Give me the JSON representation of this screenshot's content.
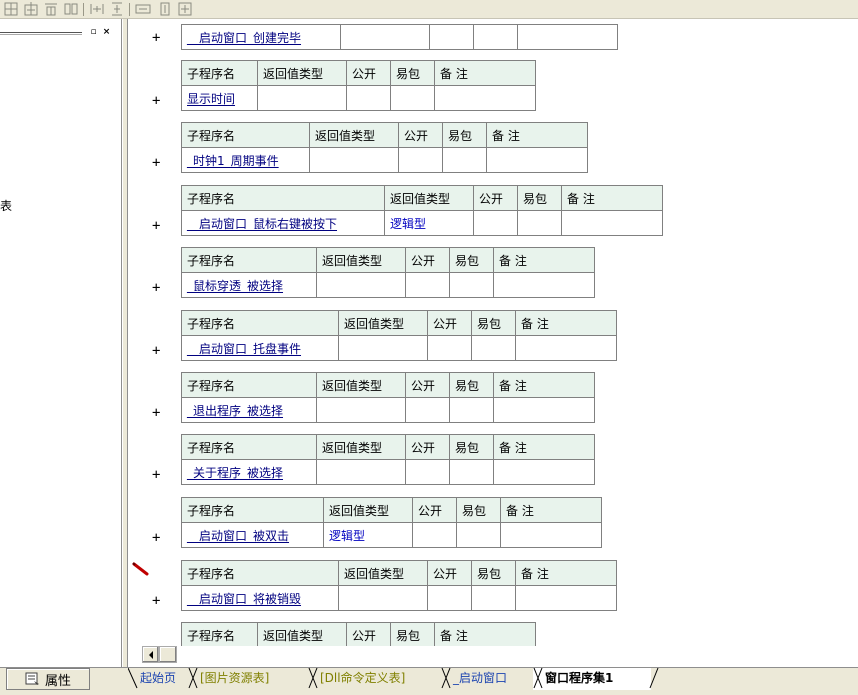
{
  "toolbar": {
    "buttons": [
      "grid-icon",
      "grid-center-icon",
      "grid-top-icon",
      "grid-split-icon",
      "hspace-icon",
      "vspace-icon",
      "hresize-icon",
      "vresize-icon",
      "center-icon"
    ]
  },
  "left_panel": {
    "minimize": "▫",
    "close": "×",
    "fragment": "表"
  },
  "plus_sign": "+",
  "headers": {
    "name": "子程序名",
    "return_type": "返回值类型",
    "public": "公开",
    "easy_pack": "易包",
    "remark": "备 注"
  },
  "subroutines": [
    {
      "name": "__启动窗口_创建完毕",
      "return_type": ""
    },
    {
      "name": "显示时间",
      "return_type": ""
    },
    {
      "name": "_时钟1_周期事件",
      "return_type": ""
    },
    {
      "name": "__启动窗口_鼠标右键被按下",
      "return_type": "逻辑型"
    },
    {
      "name": "_鼠标穿透_被选择",
      "return_type": ""
    },
    {
      "name": "__启动窗口_托盘事件",
      "return_type": ""
    },
    {
      "name": "_退出程序_被选择",
      "return_type": ""
    },
    {
      "name": "_关于程序_被选择",
      "return_type": ""
    },
    {
      "name": "__启动窗口_被双击",
      "return_type": "逻辑型"
    },
    {
      "name": "__启动窗口_将被销毁",
      "return_type": ""
    },
    {
      "name": "",
      "return_type": ""
    }
  ],
  "bottom": {
    "properties_label": "属性",
    "tabs": [
      {
        "label": "起始页"
      },
      {
        "label": "[图片资源表]"
      },
      {
        "label": "[Dll命令定义表]"
      },
      {
        "label": "_启动窗口"
      },
      {
        "label": "窗口程序集1"
      }
    ]
  },
  "colors": {
    "header_bg": "#e8f3ec",
    "name_text": "#000080",
    "type_text": "#0000c0",
    "chrome": "#ece9d8"
  }
}
